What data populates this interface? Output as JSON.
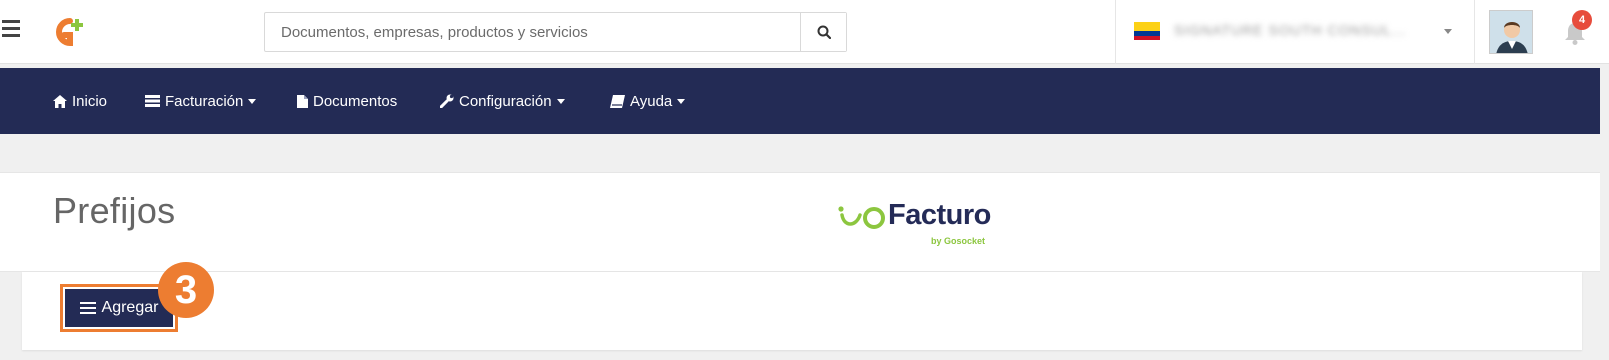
{
  "search": {
    "placeholder": "Documentos, empresas, productos y servicios"
  },
  "company": {
    "name": "SIGNATURE SOUTH CONSUL..."
  },
  "notifications": {
    "count": "4"
  },
  "nav": {
    "items": [
      {
        "label": "Inicio"
      },
      {
        "label": "Facturación"
      },
      {
        "label": "Documentos"
      },
      {
        "label": "Configuración"
      },
      {
        "label": "Ayuda"
      }
    ]
  },
  "page": {
    "title": "Prefijos"
  },
  "brand": {
    "name": "Facturo",
    "sub": "by Gosocket"
  },
  "actions": {
    "add_label": "Agregar"
  },
  "annotation": {
    "step": "3"
  },
  "colors": {
    "navy": "#232b55",
    "accent": "#ed7d31",
    "brand_green": "#8cc63f",
    "badge_red": "#e74c3c"
  }
}
